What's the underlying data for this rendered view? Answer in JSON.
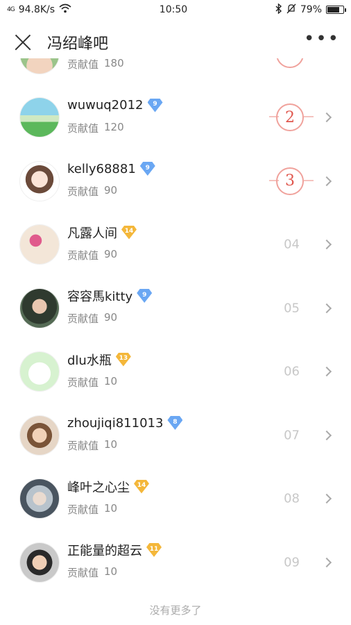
{
  "status_bar": {
    "signal": "4G",
    "speed": "94.8K/s",
    "time": "10:50",
    "battery": "79%",
    "battery_level": 0.79
  },
  "header": {
    "title": "冯绍峰吧"
  },
  "contrib_label": "贡献值",
  "partial_row": {
    "value": "180"
  },
  "rows": [
    {
      "name": "wuwuq2012",
      "level": "9",
      "level_color": "#6aa7f3",
      "value": "120",
      "rank": "2",
      "medal": true
    },
    {
      "name": "kelly68881",
      "level": "9",
      "level_color": "#6aa7f3",
      "value": "90",
      "rank": "3",
      "medal": true
    },
    {
      "name": "凡露人间",
      "level": "14",
      "level_color": "#f4b73a",
      "value": "90",
      "rank": "04",
      "medal": false
    },
    {
      "name": "容容馬kitty",
      "level": "9",
      "level_color": "#6aa7f3",
      "value": "90",
      "rank": "05",
      "medal": false
    },
    {
      "name": "dlu水瓶",
      "level": "13",
      "level_color": "#f4b73a",
      "value": "10",
      "rank": "06",
      "medal": false
    },
    {
      "name": "zhoujiqi811013",
      "level": "8",
      "level_color": "#6aa7f3",
      "value": "10",
      "rank": "07",
      "medal": false
    },
    {
      "name": "峰叶之心尘",
      "level": "14",
      "level_color": "#f4b73a",
      "value": "10",
      "rank": "08",
      "medal": false
    },
    {
      "name": "正能量的超云",
      "level": "11",
      "level_color": "#f4b73a",
      "value": "10",
      "rank": "09",
      "medal": false
    }
  ],
  "footer": {
    "text": "没有更多了"
  },
  "icons": {
    "close": "close-icon",
    "more": "more-icon",
    "chevron": "chevron-right-icon",
    "wifi": "wifi-icon",
    "bluetooth": "bluetooth-icon",
    "mute": "bell-off-icon",
    "battery": "battery-icon"
  }
}
